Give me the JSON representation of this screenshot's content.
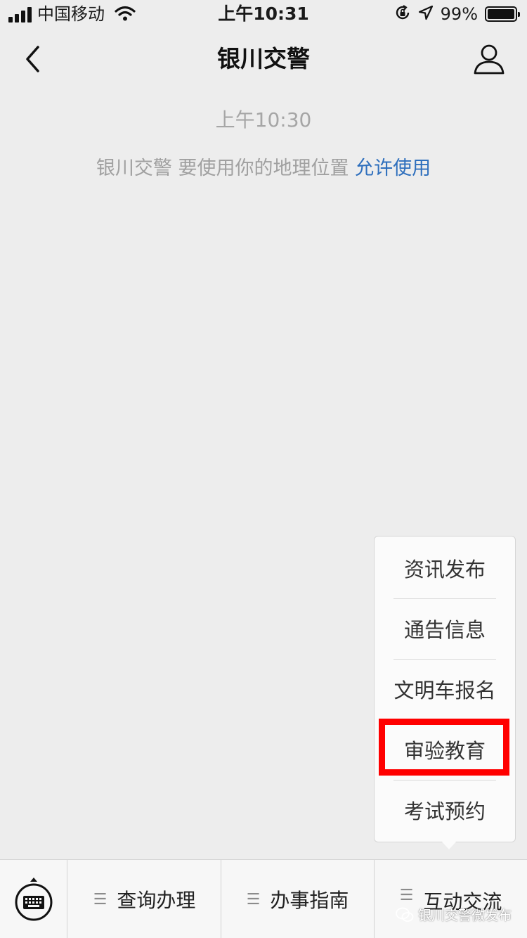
{
  "status_bar": {
    "carrier": "中国移动",
    "time": "上午10:31",
    "battery_pct": "99%",
    "battery_level": 0.99
  },
  "nav": {
    "title": "银川交警",
    "back_icon": "chevron-left-icon",
    "profile_icon": "person-icon"
  },
  "chat": {
    "timestamp": "上午10:30",
    "system_message": "银川交警 要使用你的地理位置",
    "system_link": "允许使用"
  },
  "submenu": {
    "items": [
      "资讯发布",
      "通告信息",
      "文明车报名",
      "审验教育",
      "考试预约"
    ],
    "highlighted_index": 3,
    "highlight_color": "#ff0000"
  },
  "bottom_menu": {
    "keyboard_icon": "keyboard-icon",
    "tabs": [
      "查询办理",
      "办事指南",
      "互动交流"
    ]
  },
  "watermark": {
    "text": "银川交警微发布",
    "icon": "wechat-icon"
  },
  "colors": {
    "background": "#ededed",
    "link": "#2e6fbd"
  }
}
